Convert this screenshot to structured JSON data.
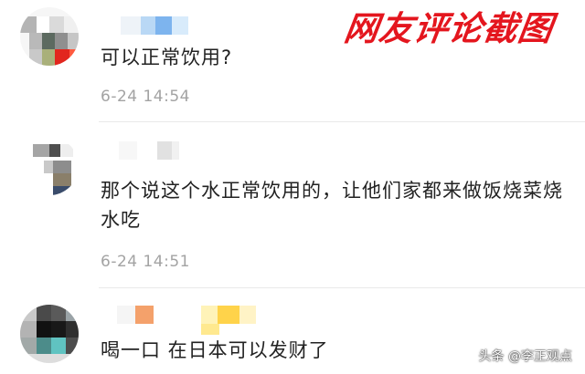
{
  "header": {
    "stamp_text": "网友评论截图"
  },
  "comments": [
    {
      "text": "可以正常饮用?",
      "time": "6-24 14:54"
    },
    {
      "text": "那个说这个水正常饮用的，让他们家都来做饭烧菜烧水吃",
      "time": "6-24 14:51"
    },
    {
      "text": "喝一口 在日本可以发财了",
      "time": ""
    }
  ],
  "watermark": {
    "text": "头条 @李正观点"
  },
  "colors": {
    "stamp_red": "#e4161e",
    "timestamp_gray": "#a3a3a3",
    "body_text": "#222222"
  },
  "icons": {
    "avatar_style": "pixelated-mosaic",
    "username_style": "pixelated-mosaic"
  }
}
